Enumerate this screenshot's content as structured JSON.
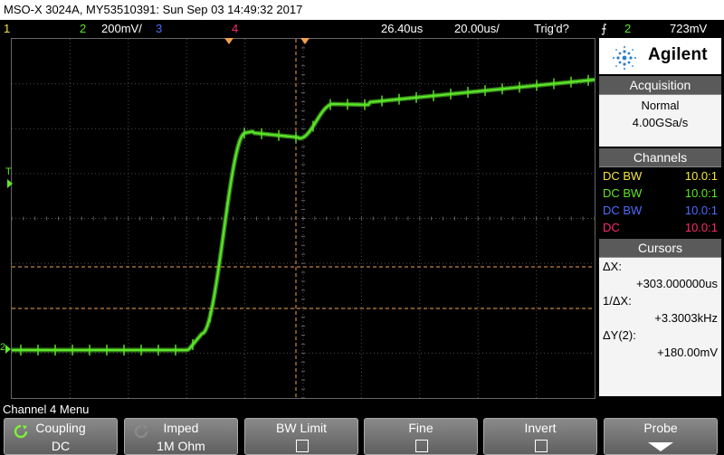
{
  "title": "MSO-X 3024A, MY53510391: Sun Sep 03 14:49:32 2017",
  "status": {
    "ch1": "1",
    "ch2": "2",
    "ch2_scale": "200mV/",
    "ch3": "3",
    "ch4": "4",
    "time_delay": "26.40us",
    "time_scale": "20.00us/",
    "trigger_status": "Trig'd?",
    "trigger_channel": "2",
    "trigger_level": "723mV"
  },
  "logo": {
    "brand": "Agilent"
  },
  "acquisition": {
    "header": "Acquisition",
    "mode": "Normal",
    "rate": "4.00GSa/s"
  },
  "channels": {
    "header": "Channels",
    "items": [
      {
        "coupling": "DC BW",
        "probe": "10.0:1",
        "color": "#f5e63c"
      },
      {
        "coupling": "DC BW",
        "probe": "10.0:1",
        "color": "#5ce62a"
      },
      {
        "coupling": "DC BW",
        "probe": "10.0:1",
        "color": "#4d6cff"
      },
      {
        "coupling": "DC",
        "probe": "10.0:1",
        "color": "#ff2a6d"
      }
    ]
  },
  "cursors": {
    "header": "Cursors",
    "dx_label": "ΔX:",
    "dx_value": "+303.000000us",
    "inv_dx_label": "1/ΔX:",
    "inv_dx_value": "+3.3003kHz",
    "dy_label": "ΔY(2):",
    "dy_value": "+180.00mV"
  },
  "screen": {
    "trigger_marker": "T",
    "ch2_ground_marker": "2",
    "trace_color": "#5ce62a",
    "cursor_color": "#f0a050"
  },
  "menu": {
    "label": "Channel 4 Menu"
  },
  "softkeys": {
    "coupling": {
      "label": "Coupling",
      "value": "DC"
    },
    "imped": {
      "label": "Imped",
      "value": "1M Ohm"
    },
    "bw_limit": {
      "label": "BW Limit"
    },
    "fine": {
      "label": "Fine"
    },
    "invert": {
      "label": "Invert"
    },
    "probe": {
      "label": "Probe"
    }
  }
}
